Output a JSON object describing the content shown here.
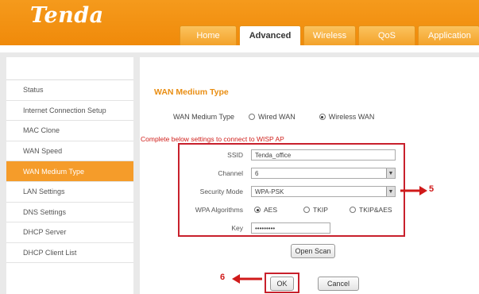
{
  "brand": {
    "logo": "Tenda",
    "accent": "#f39019"
  },
  "nav": {
    "tabs": [
      "Home",
      "Advanced",
      "Wireless",
      "QoS",
      "Application"
    ],
    "active": "Advanced"
  },
  "sidebar": {
    "items": [
      {
        "label": "Status"
      },
      {
        "label": "Internet Connection Setup"
      },
      {
        "label": "MAC Clone"
      },
      {
        "label": "WAN Speed"
      },
      {
        "label": "WAN Medium Type",
        "active": true
      },
      {
        "label": "LAN Settings"
      },
      {
        "label": "DNS Settings"
      },
      {
        "label": "DHCP Server"
      },
      {
        "label": "DHCP Client List"
      }
    ]
  },
  "page": {
    "title": "WAN Medium Type",
    "medium_label": "WAN Medium Type",
    "medium_options": [
      "Wired WAN",
      "Wireless WAN"
    ],
    "medium_selected": "Wireless WAN",
    "notice": "Complete below settings to connect to WISP AP"
  },
  "form": {
    "ssid_label": "SSID",
    "ssid_value": "Tenda_office",
    "channel_label": "Channel",
    "channel_value": "6",
    "security_label": "Security Mode",
    "security_value": "WPA-PSK",
    "alg_label": "WPA Algorithms",
    "alg_options": [
      "AES",
      "TKIP",
      "TKIP&AES"
    ],
    "alg_selected": "AES",
    "key_label": "Key",
    "key_value": "•••••••••"
  },
  "buttons": {
    "open_scan": "Open Scan",
    "ok": "OK",
    "cancel": "Cancel"
  },
  "callouts": {
    "form": "5",
    "ok": "6"
  }
}
